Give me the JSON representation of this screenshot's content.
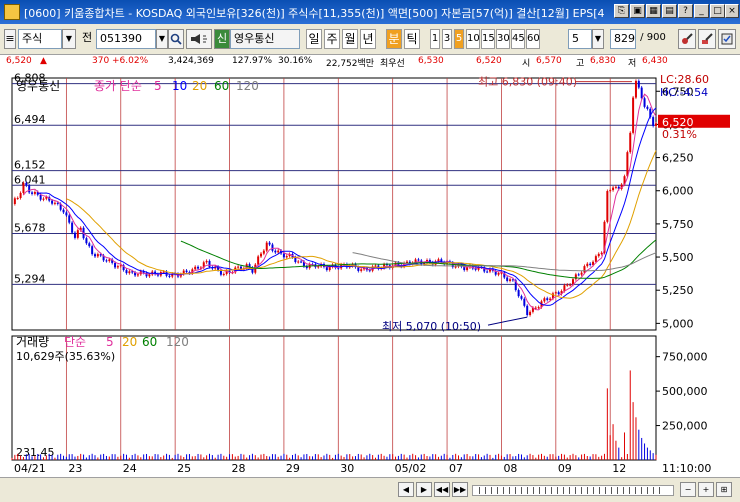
{
  "window": {
    "title": "[0600] 키움종합차트 - KOSDAQ 외국인보유[326(천)] 주식수[11,355(천)] 액면[500] 자본금[57(억)] 결산[12월] EPS[4",
    "buttons": [
      "⎘",
      "▣",
      "▦",
      "▤",
      "?",
      "_",
      "□",
      "×"
    ]
  },
  "toolbar": {
    "market": "주식",
    "all_label": "전",
    "code": "051390",
    "search_icon": "search-icon",
    "name_badge": "신",
    "stock_name": "영우통신",
    "periods": [
      "일",
      "주",
      "월",
      "년",
      "분",
      "틱"
    ],
    "active_period": "분",
    "minute_options": [
      "1",
      "3",
      "5",
      "10",
      "15",
      "30",
      "45",
      "60"
    ],
    "active_minute": "5",
    "interval_value": "5",
    "count_value": "829",
    "count_total": "/ 900"
  },
  "quote": {
    "price": "6,520",
    "arrow": "▲",
    "change": "370",
    "change_pct": "+6.02%",
    "volume": "3,424,369",
    "vol_ratio": "127.97%",
    "turnover": "30.16%",
    "amount": "22,752백만",
    "best_ask_label": "최우선",
    "best_ask": "6,530",
    "best_bid": "6,520",
    "open_label": "시",
    "open": "6,570",
    "high_label": "고",
    "high": "6,830",
    "low_label": "저",
    "low": "6,430"
  },
  "chart_data": [
    {
      "type": "line",
      "title": "영우통신",
      "legend": {
        "prefix": "종가 단순",
        "periods": [
          "5",
          "10",
          "20",
          "60",
          "120"
        ],
        "colors": [
          "#e0309c",
          "#0000ff",
          "#e0a000",
          "#008000",
          "#808080"
        ]
      },
      "hlines": [
        "6,808",
        "6,494",
        "6,152",
        "6,041",
        "5,678",
        "5,294"
      ],
      "ylim": [
        4950,
        6850
      ],
      "yticks": [
        "6,750",
        "6,500",
        "6,250",
        "6,000",
        "5,750",
        "5,500",
        "5,250",
        "5,000"
      ],
      "xticks": [
        "04/21",
        "23",
        "24",
        "25",
        "28",
        "29",
        "30",
        "05/02",
        "07",
        "08",
        "09",
        "12"
      ],
      "high_annotation": "최고 6,830 (09:40)",
      "low_annotation": "최저 5,070 (10:50)",
      "lc": "LC:28.60",
      "hc": "HC:-4.54",
      "last_price": "6,520",
      "last_pct": "0.31%",
      "price_anchors": [
        [
          0,
          5900
        ],
        [
          2,
          5950
        ],
        [
          4,
          6050
        ],
        [
          6,
          6000
        ],
        [
          10,
          5950
        ],
        [
          14,
          5920
        ],
        [
          18,
          5850
        ],
        [
          22,
          5650
        ],
        [
          24,
          5720
        ],
        [
          26,
          5600
        ],
        [
          28,
          5530
        ],
        [
          32,
          5490
        ],
        [
          36,
          5440
        ],
        [
          38,
          5420
        ],
        [
          42,
          5370
        ],
        [
          44,
          5380
        ],
        [
          48,
          5370
        ],
        [
          52,
          5380
        ],
        [
          56,
          5360
        ],
        [
          60,
          5380
        ],
        [
          64,
          5410
        ],
        [
          68,
          5460
        ],
        [
          70,
          5420
        ],
        [
          72,
          5400
        ],
        [
          74,
          5370
        ],
        [
          78,
          5410
        ],
        [
          82,
          5430
        ],
        [
          84,
          5400
        ],
        [
          87,
          5530
        ],
        [
          89,
          5600
        ],
        [
          91,
          5560
        ],
        [
          94,
          5520
        ],
        [
          98,
          5500
        ],
        [
          100,
          5460
        ],
        [
          103,
          5430
        ],
        [
          106,
          5440
        ],
        [
          110,
          5420
        ],
        [
          114,
          5430
        ],
        [
          118,
          5440
        ],
        [
          120,
          5420
        ],
        [
          123,
          5400
        ],
        [
          126,
          5420
        ],
        [
          130,
          5430
        ],
        [
          134,
          5440
        ],
        [
          138,
          5450
        ],
        [
          140,
          5470
        ],
        [
          144,
          5460
        ],
        [
          147,
          5460
        ],
        [
          150,
          5470
        ],
        [
          154,
          5440
        ],
        [
          158,
          5420
        ],
        [
          162,
          5420
        ],
        [
          166,
          5400
        ],
        [
          170,
          5380
        ],
        [
          172,
          5350
        ],
        [
          175,
          5310
        ],
        [
          178,
          5170
        ],
        [
          180,
          5080
        ],
        [
          182,
          5100
        ],
        [
          185,
          5160
        ],
        [
          188,
          5200
        ],
        [
          192,
          5250
        ],
        [
          196,
          5330
        ],
        [
          200,
          5420
        ],
        [
          204,
          5490
        ],
        [
          206,
          5550
        ],
        [
          208,
          5980
        ],
        [
          210,
          6040
        ],
        [
          212,
          6000
        ],
        [
          214,
          6120
        ],
        [
          216,
          6430
        ],
        [
          217,
          6720
        ],
        [
          218,
          6830
        ],
        [
          219,
          6760
        ],
        [
          220,
          6700
        ],
        [
          221,
          6650
        ],
        [
          222,
          6610
        ],
        [
          223,
          6540
        ],
        [
          224,
          6500
        ],
        [
          225,
          6520
        ]
      ]
    },
    {
      "type": "bar",
      "title": "거래량",
      "legend": {
        "prefix": "단순",
        "periods": [
          "5",
          "20",
          "60",
          "120"
        ],
        "colors": [
          "#e0309c",
          "#e0a000",
          "#008000",
          "#808080"
        ]
      },
      "current_volume": "10,629주(35.63%)",
      "ylim": [
        0,
        900000
      ],
      "yticks": [
        "750,000",
        "500,000",
        "250,000"
      ],
      "avg_label": "231.45",
      "spikes": [
        [
          208,
          520000
        ],
        [
          209,
          180000
        ],
        [
          210,
          260000
        ],
        [
          211,
          140000
        ],
        [
          212,
          90000
        ],
        [
          214,
          200000
        ],
        [
          216,
          650000
        ],
        [
          217,
          420000
        ],
        [
          218,
          310000
        ],
        [
          219,
          220000
        ],
        [
          220,
          160000
        ],
        [
          221,
          120000
        ],
        [
          222,
          90000
        ],
        [
          223,
          70000
        ],
        [
          224,
          50000
        ]
      ]
    }
  ],
  "scrollbar": {
    "buttons": [
      "◀",
      "▶",
      "◀◀",
      "▶▶"
    ],
    "zoom": [
      "−",
      "+"
    ],
    "time": "11:10:00"
  }
}
